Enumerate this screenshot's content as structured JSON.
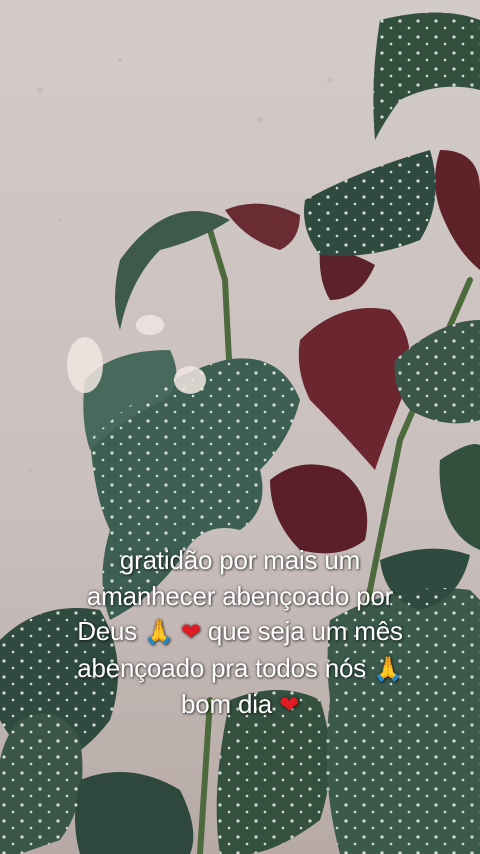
{
  "caption": {
    "line1": "gratidão por mais um",
    "line2": "amanhecer abençoado por",
    "line3a": "Deus",
    "line3b": "que seja um mês",
    "line4": "abençoado pra todos nós",
    "line5": "bom dia",
    "pray_glyph": "🙏",
    "heart_glyph": "❤"
  },
  "colors": {
    "wall": "#cfc6c4",
    "leaf_green": "#3d5a4d",
    "leaf_red": "#6b2630",
    "spots": "#e8ece6"
  }
}
